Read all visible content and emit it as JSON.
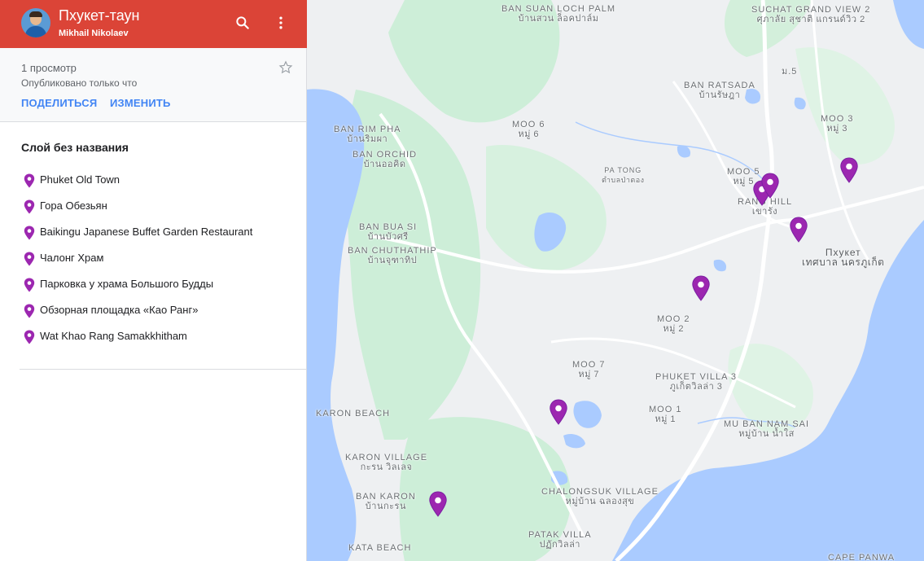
{
  "header": {
    "title": "Пхукет-таун",
    "owner": "Mikhail Nikolaev"
  },
  "info": {
    "views": "1 просмотр",
    "published": "Опубликовано только что",
    "share_label": "ПОДЕЛИТЬСЯ",
    "edit_label": "ИЗМЕНИТЬ"
  },
  "layer": {
    "title": "Слой без названия",
    "places": [
      "Phuket Old Town",
      "Гора Обезьян",
      "Baikingu Japanese Buffet Garden Restaurant",
      "Чалонг Храм",
      "Парковка у храма Большого Будды",
      "Обзорная площадка «Као Ранг»",
      "Wat Khao Rang Samakkhitham"
    ]
  },
  "colors": {
    "header": "#db4437",
    "accent": "#4285f4",
    "marker": "#9c27b0",
    "water": "#aacbff",
    "land": "#eef0f2",
    "forest": "#cdeed8"
  },
  "icons": {
    "search": "search-icon",
    "menu": "more-vert-icon",
    "star": "star-outline-icon",
    "place": "place-marker-icon"
  },
  "map": {
    "labels": [
      {
        "en": "BAN SUAN LOCH PALM",
        "th": "บ้านสวน ล็อคปาล์ม"
      },
      {
        "en": "SUCHAT GRAND VIEW 2",
        "th": "ศุภาลัย สุชาติ แกรนด์วิว 2"
      },
      {
        "en": "ม.5",
        "th": ""
      },
      {
        "en": "BAN RATSADA",
        "th": "บ้านรัษฎา"
      },
      {
        "en": "MOO 3",
        "th": "หมู่ 3"
      },
      {
        "en": "BAN RIM PHA",
        "th": "บ้านริมผา"
      },
      {
        "en": "MOO 6",
        "th": "หมู่ 6"
      },
      {
        "en": "BAN ORCHID",
        "th": "บ้านออคิด"
      },
      {
        "en": "PA TONG",
        "th": "ตำบลป่าตอง"
      },
      {
        "en": "MOO 5",
        "th": "หมู่ 5"
      },
      {
        "en": "RANG HILL",
        "th": "เขารัง"
      },
      {
        "en": "BAN BUA SI",
        "th": "บ้านบัวศรี"
      },
      {
        "en": "BAN CHUTHATHIP",
        "th": "บ้านจุฑาทิป"
      },
      {
        "en": "Пхукет",
        "th": "เทศบาล นครภูเก็ต"
      },
      {
        "en": "MOO 2",
        "th": "หมู่ 2"
      },
      {
        "en": "MOO 7",
        "th": "หมู่ 7"
      },
      {
        "en": "PHUKET VILLA 3",
        "th": "ภูเก็ตวิลล่า 3"
      },
      {
        "en": "MOO 1",
        "th": "หมู่ 1"
      },
      {
        "en": "KARON BEACH",
        "th": ""
      },
      {
        "en": "MU BAN NAM SAI",
        "th": "หมู่บ้าน น้ำใส"
      },
      {
        "en": "KARON VILLAGE",
        "th": "กะรน วิลเลจ"
      },
      {
        "en": "CHALONGSUK VILLAGE",
        "th": "หมู่บ้าน ฉลองสุข"
      },
      {
        "en": "BAN KARON",
        "th": "บ้านกะรน"
      },
      {
        "en": "PATAK VILLA",
        "th": "ปฏักวิลล่า"
      },
      {
        "en": "KATA BEACH",
        "th": ""
      },
      {
        "en": "CAPE PANWA",
        "th": ""
      }
    ]
  }
}
